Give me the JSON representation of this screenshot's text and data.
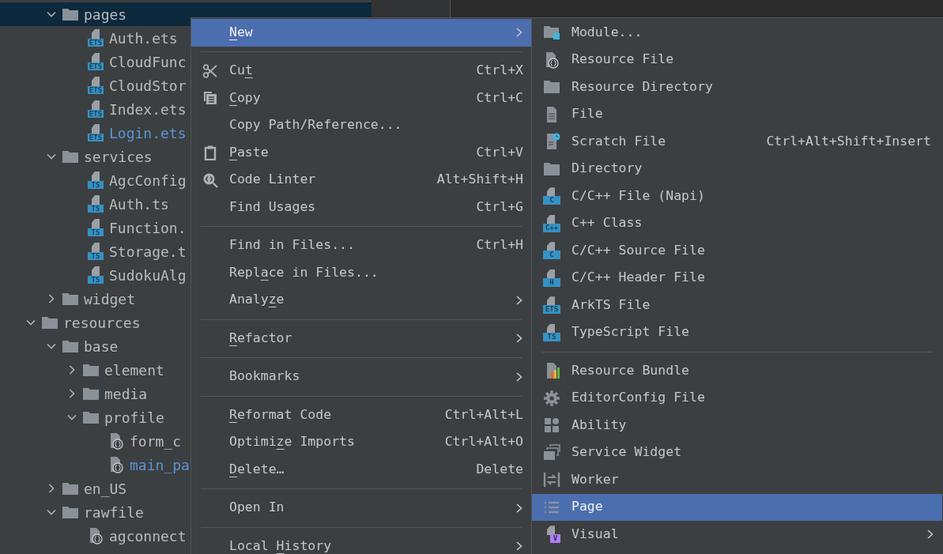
{
  "tree": {
    "partial_branch": [
      {
        "label": "pages",
        "kind": "folder",
        "expanded": true,
        "selected": true,
        "children": [
          {
            "label": "Auth.ets",
            "kind": "file",
            "badge": "ETS",
            "selected": false
          },
          {
            "label": "CloudFunc",
            "kind": "file",
            "badge": "ETS",
            "selected": false
          },
          {
            "label": "CloudStor",
            "kind": "file",
            "badge": "ETS",
            "selected": false
          },
          {
            "label": "Index.ets",
            "kind": "file",
            "badge": "ETS",
            "selected": false
          },
          {
            "label": "Login.ets",
            "kind": "file",
            "badge": "ETS",
            "selected": false,
            "color": "#5c94d5"
          }
        ]
      },
      {
        "label": "services",
        "kind": "folder",
        "expanded": true,
        "selected": false,
        "children": [
          {
            "label": "AgcConfig",
            "kind": "file",
            "badge": "TS",
            "selected": false
          },
          {
            "label": "Auth.ts",
            "kind": "file",
            "badge": "TS",
            "selected": false
          },
          {
            "label": "Function.",
            "kind": "file",
            "badge": "TS",
            "selected": false
          },
          {
            "label": "Storage.t",
            "kind": "file",
            "badge": "TS",
            "selected": false
          },
          {
            "label": "SudokuAlg",
            "kind": "file",
            "badge": "TS",
            "selected": false
          }
        ]
      },
      {
        "label": "widget",
        "kind": "folder",
        "expanded": false,
        "selected": false
      }
    ],
    "items": [
      {
        "label": "resources",
        "kind": "folder",
        "expanded": true,
        "selected": false,
        "children": [
          {
            "label": "base",
            "kind": "folder",
            "expanded": true,
            "selected": false,
            "children": [
              {
                "label": "element",
                "kind": "folder",
                "expanded": false,
                "selected": false
              },
              {
                "label": "media",
                "kind": "folder",
                "expanded": false,
                "selected": false
              },
              {
                "label": "profile",
                "kind": "folder",
                "expanded": true,
                "selected": false,
                "children": [
                  {
                    "label": "form_c",
                    "kind": "json",
                    "selected": false
                  },
                  {
                    "label": "main_pa",
                    "kind": "json",
                    "selected": false,
                    "color": "#5c94d5"
                  }
                ]
              }
            ]
          },
          {
            "label": "en_US",
            "kind": "folder",
            "expanded": false,
            "selected": false
          },
          {
            "label": "rawfile",
            "kind": "folder",
            "expanded": true,
            "selected": false,
            "children": [
              {
                "label": "agconnect",
                "kind": "json",
                "selected": false
              }
            ]
          }
        ]
      }
    ]
  },
  "context_menu": {
    "groups": [
      [
        {
          "mnemonic": "N",
          "label_after": "ew",
          "submenu": true,
          "selected": true
        }
      ],
      [
        {
          "label": "Cu",
          "mnemonic": "t",
          "shortcut": "Ctrl+X",
          "submenu": false,
          "selected": false
        },
        {
          "mnemonic": "C",
          "label_after": "opy",
          "shortcut": "Ctrl+C",
          "submenu": false,
          "selected": false
        },
        {
          "label": "Copy Path/Reference...",
          "submenu": false,
          "selected": false
        },
        {
          "mnemonic": "P",
          "label_after": "aste",
          "shortcut": "Ctrl+V",
          "submenu": false,
          "selected": false
        },
        {
          "label": "Code Linter",
          "shortcut": "Alt+Shift+H",
          "submenu": false,
          "selected": false
        },
        {
          "label": "Find Usages",
          "shortcut": "Ctrl+G",
          "submenu": false,
          "selected": false
        }
      ],
      [
        {
          "label": "Find in Files...",
          "shortcut": "Ctrl+H",
          "submenu": false,
          "selected": false
        },
        {
          "label": "Repl",
          "mnemonic": "a",
          "label_after": "ce in Files...",
          "submenu": false,
          "selected": false
        },
        {
          "label": "Analy",
          "mnemonic": "z",
          "label_after": "e",
          "submenu": true,
          "selected": false
        }
      ],
      [
        {
          "mnemonic": "R",
          "label_after": "efactor",
          "submenu": true,
          "selected": false
        }
      ],
      [
        {
          "label": "Bookmarks",
          "submenu": true,
          "selected": false
        }
      ],
      [
        {
          "mnemonic": "R",
          "label_after": "eformat Code",
          "shortcut": "Ctrl+Alt+L",
          "submenu": false,
          "selected": false
        },
        {
          "label": "Optimi",
          "mnemonic": "z",
          "label_after": "e Imports",
          "shortcut": "Ctrl+Alt+O",
          "submenu": false,
          "selected": false
        },
        {
          "mnemonic": "D",
          "label_after": "elete…",
          "shortcut": "Delete",
          "submenu": false,
          "selected": false
        }
      ],
      [
        {
          "label": "Open In",
          "submenu": true,
          "selected": false
        }
      ],
      [
        {
          "label": "Local ",
          "mnemonic": "H",
          "label_after": "istory",
          "submenu": true,
          "selected": false
        }
      ]
    ]
  },
  "new_submenu": {
    "groups": [
      [
        {
          "label": "Module...",
          "submenu": false,
          "selected": false
        },
        {
          "label": "Resource File",
          "submenu": false,
          "selected": false
        },
        {
          "label": "Resource Directory",
          "submenu": false,
          "selected": false
        },
        {
          "label": "File",
          "submenu": false,
          "selected": false
        },
        {
          "label": "Scratch File",
          "shortcut": "Ctrl+Alt+Shift+Insert",
          "submenu": false,
          "selected": false
        },
        {
          "label": "Directory",
          "submenu": false,
          "selected": false
        },
        {
          "label": "C/C++ File (Napi)",
          "badge": "C",
          "submenu": false,
          "selected": false
        },
        {
          "label": "C++ Class",
          "badge": "C++",
          "submenu": false,
          "selected": false
        },
        {
          "label": "C/C++ Source File",
          "badge": "C",
          "submenu": false,
          "selected": false
        },
        {
          "label": "C/C++ Header File",
          "badge": "H",
          "submenu": false,
          "selected": false
        },
        {
          "label": "ArkTS File",
          "badge": "ETS",
          "submenu": false,
          "selected": false
        },
        {
          "label": "TypeScript File",
          "badge": "TS",
          "submenu": false,
          "selected": false
        }
      ],
      [
        {
          "label": "Resource Bundle",
          "submenu": false,
          "selected": false
        },
        {
          "label": "EditorConfig File",
          "submenu": false,
          "selected": false
        },
        {
          "label": "Ability",
          "submenu": false,
          "selected": false
        },
        {
          "label": "Service Widget",
          "submenu": false,
          "selected": false
        },
        {
          "label": "Worker",
          "submenu": false,
          "selected": false
        },
        {
          "label": "Page",
          "submenu": false,
          "selected": true
        },
        {
          "label": "Visual",
          "badge": "V",
          "submenu": true,
          "selected": false
        }
      ]
    ]
  }
}
